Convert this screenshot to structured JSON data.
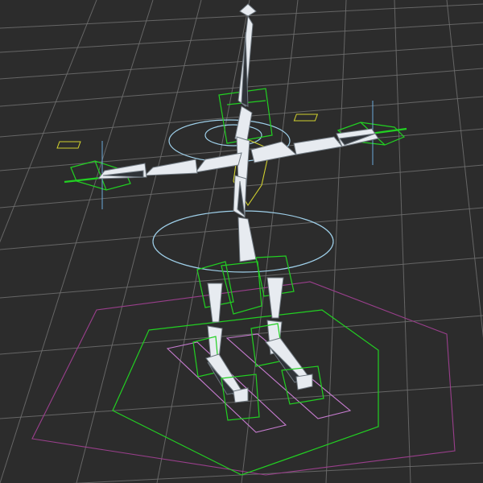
{
  "viewport": {
    "view": "Perspective",
    "background": "#2c2c2c",
    "grid_color": "#707070"
  },
  "rig": {
    "bone_color": "#e7ebf0",
    "controls": {
      "ik_box_color": "#22d022",
      "ring_color": "#9fd0ea",
      "hand_marker_color": "#cfcf2e",
      "foot_pad_color": "#c77cd0",
      "footprint_color": "#9a3f8c"
    }
  }
}
